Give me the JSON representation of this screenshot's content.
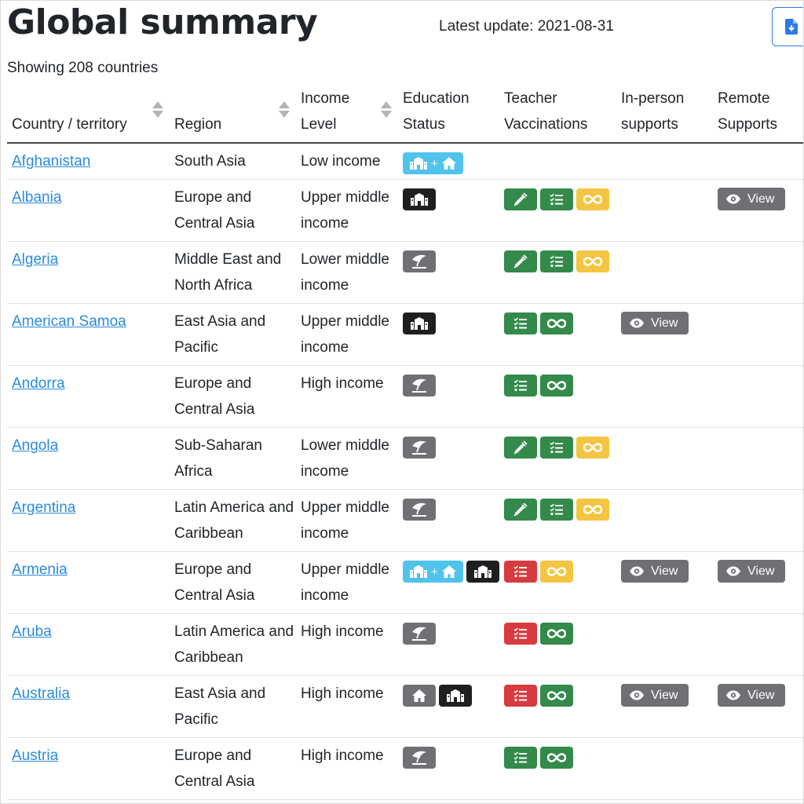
{
  "header": {
    "title": "Global summary",
    "latest_update": "Latest update: 2021-08-31",
    "showing": "Showing 208 countries",
    "download_icon": "file-download-icon"
  },
  "columns": [
    {
      "label": "Country / territory",
      "sortable": true
    },
    {
      "label": "Region",
      "sortable": true
    },
    {
      "label": "Income Level",
      "sortable": true
    },
    {
      "label": "Education Status",
      "sortable": false
    },
    {
      "label": "Teacher Vaccinations",
      "sortable": false
    },
    {
      "label": "In-person supports",
      "sortable": false
    },
    {
      "label": "Remote Supports",
      "sortable": false
    }
  ],
  "view_label": "View",
  "badge_colors": {
    "closed": "#1f1f1f",
    "gray": "#6e7074",
    "hybrid": "#4fc3ec",
    "green": "#338a4a",
    "red": "#d73b3e",
    "yellow": "#f4c542",
    "link": "#2a8be0"
  },
  "rows": [
    {
      "country": "Afghanistan",
      "region": "South Asia",
      "income": "Low income",
      "education": [
        "hybrid"
      ],
      "vaccinations": [],
      "in_person": false,
      "remote": false
    },
    {
      "country": "Albania",
      "region": "Europe and Central Asia",
      "income": "Upper middle income",
      "education": [
        "school-dark"
      ],
      "vaccinations": [
        "syringe-green",
        "checklist-green",
        "infinity-yellow"
      ],
      "in_person": false,
      "remote": true
    },
    {
      "country": "Algeria",
      "region": "Middle East and North Africa",
      "income": "Lower middle income",
      "education": [
        "umbrella"
      ],
      "vaccinations": [
        "syringe-green",
        "checklist-green",
        "infinity-yellow"
      ],
      "in_person": false,
      "remote": false
    },
    {
      "country": "American Samoa",
      "region": "East Asia and Pacific",
      "income": "Upper middle income",
      "education": [
        "school-dark"
      ],
      "vaccinations": [
        "checklist-green",
        "infinity-green"
      ],
      "in_person": true,
      "remote": false
    },
    {
      "country": "Andorra",
      "region": "Europe and Central Asia",
      "income": "High income",
      "education": [
        "umbrella"
      ],
      "vaccinations": [
        "checklist-green",
        "infinity-green"
      ],
      "in_person": false,
      "remote": false
    },
    {
      "country": "Angola",
      "region": "Sub-Saharan Africa",
      "income": "Lower middle income",
      "education": [
        "umbrella"
      ],
      "vaccinations": [
        "syringe-green",
        "checklist-green",
        "infinity-yellow"
      ],
      "in_person": false,
      "remote": false
    },
    {
      "country": "Argentina",
      "region": "Latin America and Caribbean",
      "income": "Upper middle income",
      "education": [
        "umbrella"
      ],
      "vaccinations": [
        "syringe-green",
        "checklist-green",
        "infinity-yellow"
      ],
      "in_person": false,
      "remote": false
    },
    {
      "country": "Armenia",
      "region": "Europe and Central Asia",
      "income": "Upper middle income",
      "education": [
        "hybrid",
        "school-dark"
      ],
      "vaccinations": [
        "checklist-red",
        "infinity-yellow"
      ],
      "in_person": true,
      "remote": true
    },
    {
      "country": "Aruba",
      "region": "Latin America and Caribbean",
      "income": "High income",
      "education": [
        "umbrella"
      ],
      "vaccinations": [
        "checklist-red",
        "infinity-green"
      ],
      "in_person": false,
      "remote": false
    },
    {
      "country": "Australia",
      "region": "East Asia and Pacific",
      "income": "High income",
      "education": [
        "home",
        "school-dark"
      ],
      "vaccinations": [
        "checklist-red",
        "infinity-green"
      ],
      "in_person": true,
      "remote": true
    },
    {
      "country": "Austria",
      "region": "Europe and Central Asia",
      "income": "High income",
      "education": [
        "umbrella"
      ],
      "vaccinations": [
        "checklist-green",
        "infinity-green"
      ],
      "in_person": false,
      "remote": false
    }
  ]
}
